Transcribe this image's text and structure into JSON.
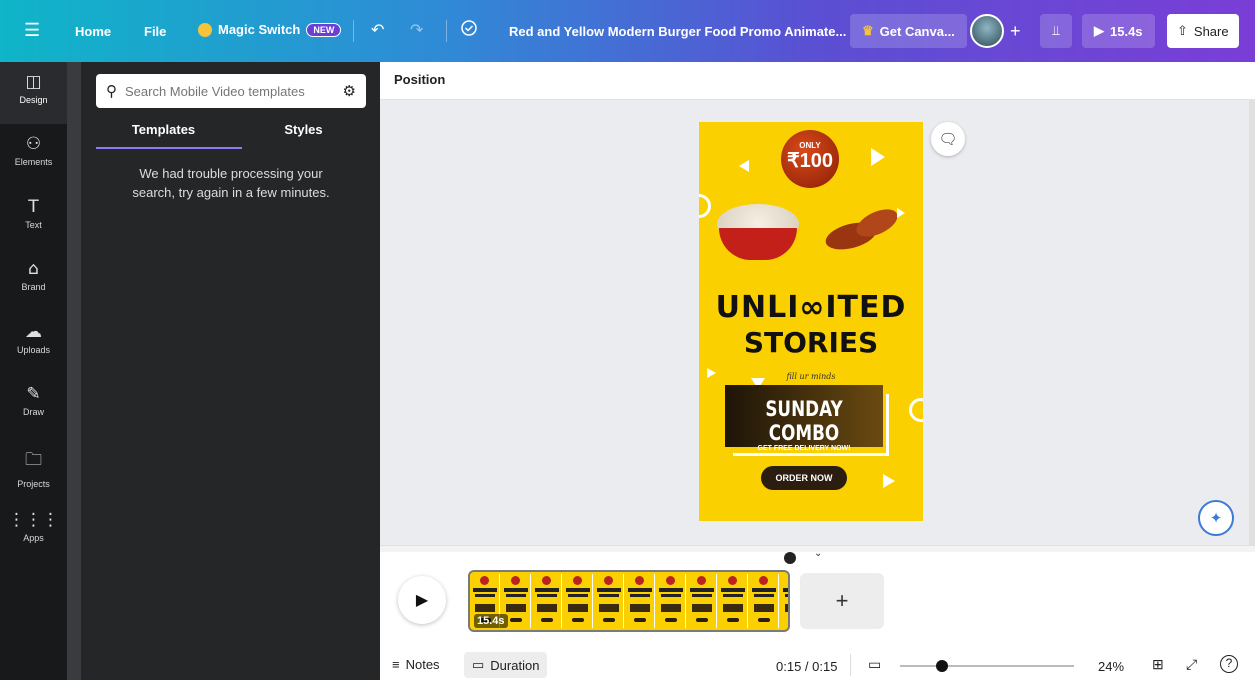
{
  "topbar": {
    "home": "Home",
    "file": "File",
    "magic_switch": "Magic Switch",
    "new_badge": "NEW",
    "doc_title": "Red and Yellow Modern Burger Food Promo Animate...",
    "get_canva": "Get Canva...",
    "play_duration": "15.4s",
    "share": "Share"
  },
  "rail": {
    "items": [
      {
        "label": "Design",
        "icon": "design-icon"
      },
      {
        "label": "Elements",
        "icon": "elements-icon"
      },
      {
        "label": "Text",
        "icon": "text-icon"
      },
      {
        "label": "Brand",
        "icon": "brand-icon"
      },
      {
        "label": "Uploads",
        "icon": "uploads-icon"
      },
      {
        "label": "Draw",
        "icon": "draw-icon"
      },
      {
        "label": "Projects",
        "icon": "projects-icon"
      },
      {
        "label": "Apps",
        "icon": "apps-icon"
      }
    ]
  },
  "panel": {
    "search_placeholder": "Search Mobile Video templates",
    "tab_templates": "Templates",
    "tab_styles": "Styles",
    "error_message": "We had trouble processing your search, try again in a few minutes."
  },
  "editor": {
    "header_label": "Position"
  },
  "poster": {
    "only": "ONLY",
    "price": "₹100",
    "headline_1": "UNLI∞ITED",
    "headline_2": "STORIES",
    "tagline": "fill ur minds",
    "combo": "SUNDAY COMBO",
    "delivery": "GET FREE DELIVERY NOW!",
    "cta": "ORDER NOW"
  },
  "timeline": {
    "clip_duration": "15.4s",
    "add": "+"
  },
  "footer": {
    "notes": "Notes",
    "duration": "Duration",
    "time": "0:15 / 0:15",
    "zoom": "24%",
    "zoom_level": 0.24
  },
  "colors": {
    "poster_yellow": "#fbd000",
    "accent_purple": "#8b7cf6",
    "rail_bg": "#18191b",
    "panel_bg": "#252627"
  }
}
